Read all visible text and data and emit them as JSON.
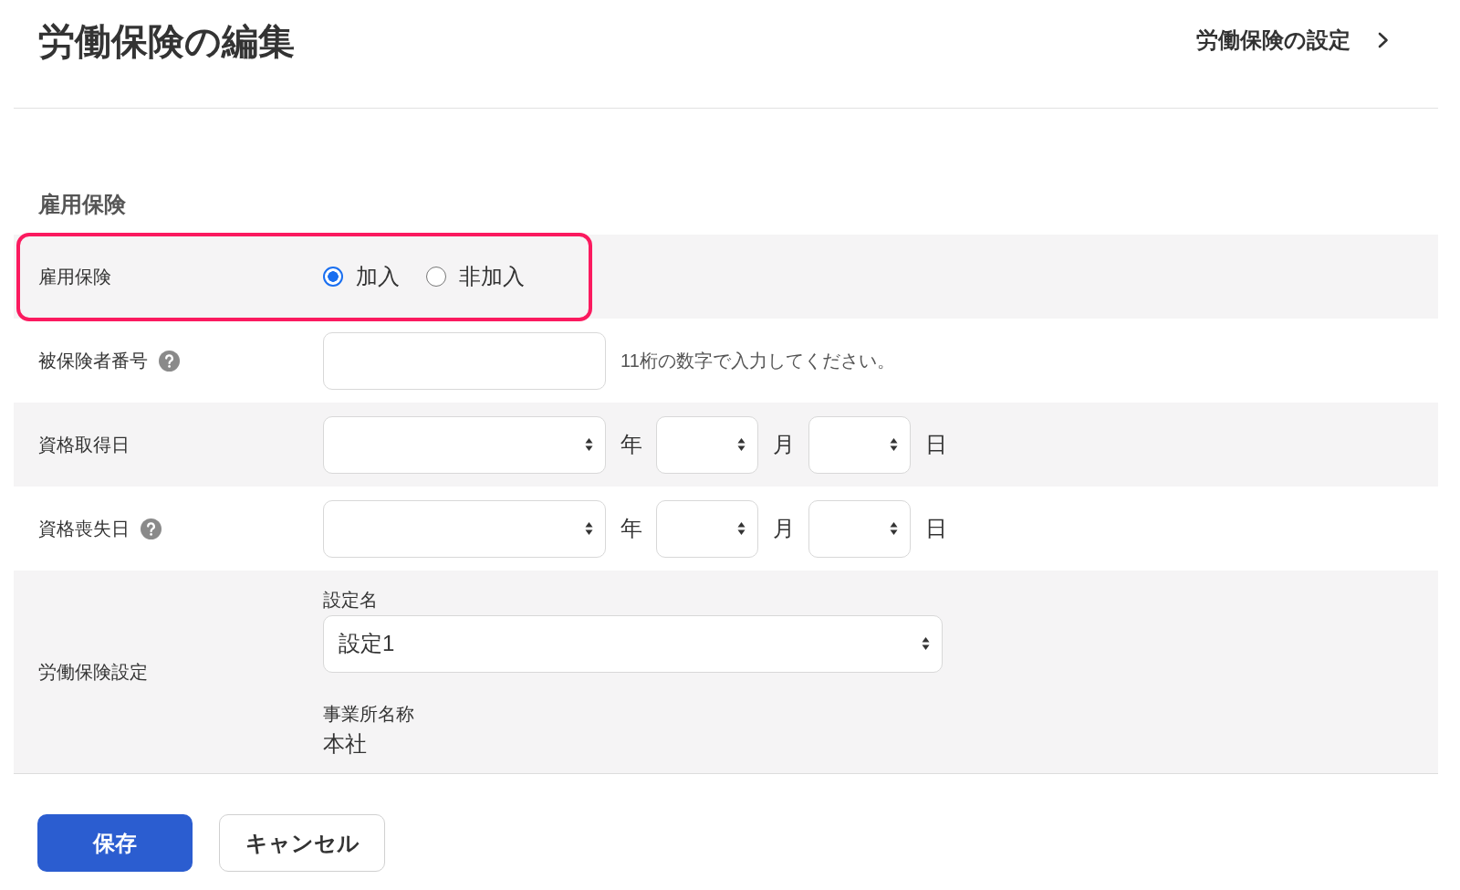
{
  "header": {
    "title": "労働保険の編集",
    "settings_link": {
      "label": "労働保険の設定"
    }
  },
  "section": {
    "title": "雇用保険"
  },
  "rows": [
    {
      "kind": "radio",
      "label": "雇用保険",
      "help": false,
      "highlighted": true,
      "options": [
        {
          "label": "加入",
          "selected": true
        },
        {
          "label": "非加入",
          "selected": false
        }
      ]
    },
    {
      "kind": "text",
      "label": "被保険者番号",
      "help": true,
      "highlighted": false,
      "hint": "11桁の数字で入力してください。"
    },
    {
      "kind": "date",
      "label": "資格取得日",
      "help": false,
      "highlighted": false,
      "units": [
        "年",
        "月",
        "日"
      ]
    },
    {
      "kind": "date",
      "label": "資格喪失日",
      "help": true,
      "highlighted": false,
      "units": [
        "年",
        "月",
        "日"
      ]
    },
    {
      "kind": "setting",
      "label": "労働保険設定",
      "help": false,
      "highlighted": false,
      "select_label": "設定名",
      "select_value": "設定1",
      "office_label": "事業所名称",
      "office_value": "本社"
    }
  ],
  "buttons": [
    {
      "kind": "primary",
      "label": "保存"
    },
    {
      "kind": "secondary",
      "label": "キャンセル"
    }
  ]
}
